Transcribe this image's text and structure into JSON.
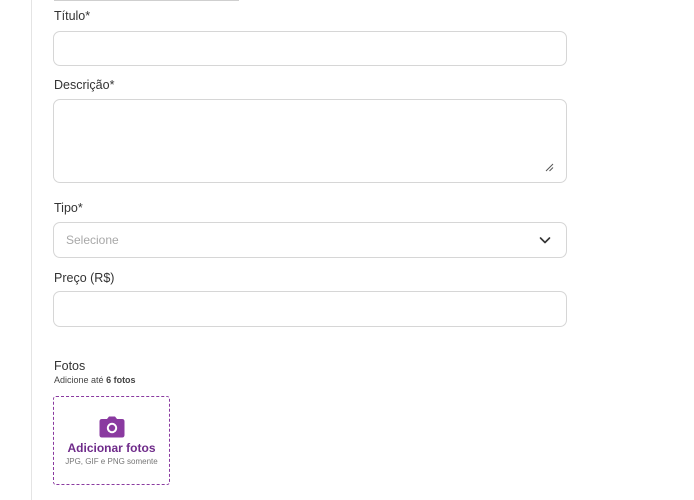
{
  "form": {
    "title": {
      "label": "Título*",
      "value": ""
    },
    "description": {
      "label": "Descrição*",
      "value": ""
    },
    "type": {
      "label": "Tipo*",
      "placeholder": "Selecione"
    },
    "price": {
      "label": "Preço (R$)",
      "value": ""
    }
  },
  "photos": {
    "title": "Fotos",
    "hint_prefix": "Adicione até",
    "hint_count": "6 fotos",
    "upload_label": "Adicionar fotos",
    "upload_formats": "JPG, GIF e PNG somente",
    "icon": "camera-icon"
  },
  "colors": {
    "accent": "#8a3aa0",
    "accent_text": "#6f2b8a",
    "border": "#d6d6d6"
  }
}
